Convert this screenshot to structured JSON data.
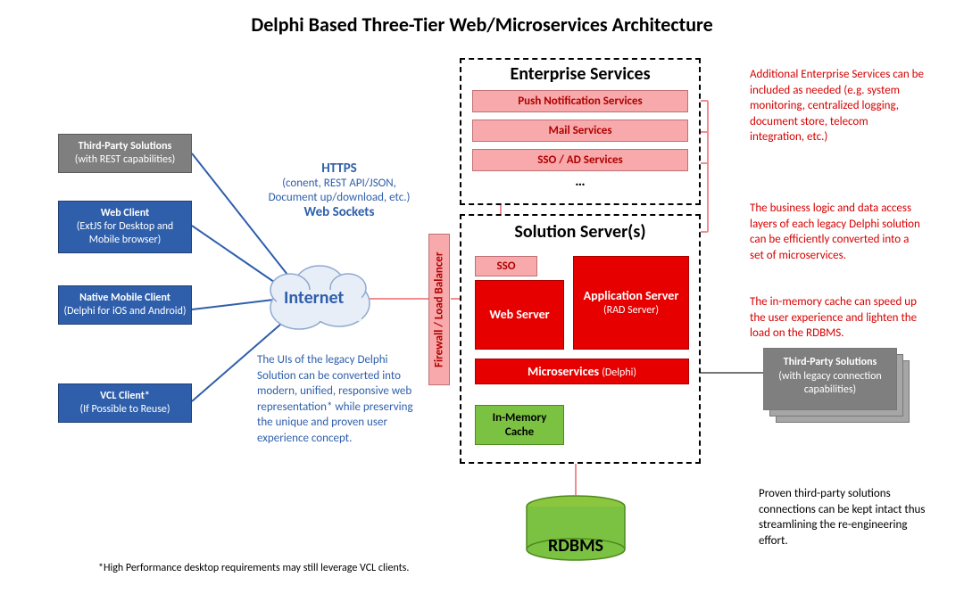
{
  "title": "Delphi Based Three-Tier Web/Microservices Architecture",
  "clients": {
    "third_party": {
      "title": "Third-Party Solutions",
      "sub": "(with REST capabilities)"
    },
    "web": {
      "title": "Web Client",
      "sub": "(ExtJS for Desktop and Mobile browser)"
    },
    "mobile": {
      "title": "Native Mobile Client",
      "sub": "(Delphi for iOS and Android)"
    },
    "vcl": {
      "title": "VCL Client*",
      "sub": "(If Possible to Reuse)"
    }
  },
  "internet": "Internet",
  "protocols": {
    "https": "HTTPS",
    "https_sub": "(conent, REST API/JSON, Document up/download, etc.)",
    "ws": "Web Sockets"
  },
  "firewall": "Firewall / Load Balancer",
  "enterprise": {
    "title": "Enterprise Services",
    "push": "Push Notification Services",
    "mail": "Mail Services",
    "sso": "SSO / AD Services",
    "dots": "…"
  },
  "solution": {
    "title": "Solution Server(s)",
    "sso": "SSO",
    "web_server": "Web Server",
    "app_server": "Application Server",
    "app_server_sub": "(RAD Server)",
    "micro": "Microservices",
    "micro_sub": "(Delphi)",
    "cache": "In-Memory Cache"
  },
  "rdbms": "RDBMS",
  "tp_legacy": {
    "title": "Third-Party Solutions",
    "sub": "(with legacy connection capabilities)"
  },
  "notes": {
    "ui_legacy": "The UIs of the legacy Delphi Solution can be converted into modern, unified, responsive web representation* while preserving the unique and proven user experience concept.",
    "foot": "*High Performance desktop requirements may still leverage VCL clients.",
    "ent_add": "Additional Enterprise Services can be included as needed (e.g. system monitoring, centralized logging, document store, telecom integration, etc.)",
    "biz_logic": "The business logic and data access layers of each legacy Delphi solution can be efficiently converted into a set of microservices.",
    "cache_note": "The in-memory cache can speed up the user experience and lighten the load on the RDBMS.",
    "tp_note": "Proven third-party solutions connections can be kept intact thus streamlining the re-engineering effort."
  }
}
